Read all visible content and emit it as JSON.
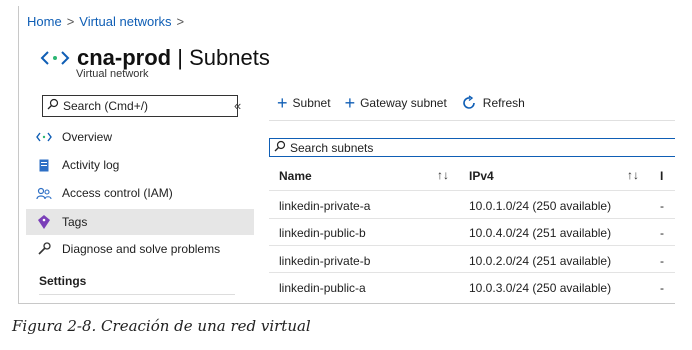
{
  "breadcrumb": {
    "home": "Home",
    "separator": ">",
    "virtual_networks": "Virtual networks"
  },
  "header": {
    "resource": "cna-prod",
    "divider": "|",
    "blade": "Subnets",
    "subtitle": "Virtual network"
  },
  "sidebar": {
    "search_placeholder": "Search (Cmd+/)",
    "collapse": "«",
    "items": [
      {
        "label": "Overview",
        "icon": "vnet-icon"
      },
      {
        "label": "Activity log",
        "icon": "activity-log-icon"
      },
      {
        "label": "Access control (IAM)",
        "icon": "iam-icon"
      },
      {
        "label": "Tags",
        "icon": "tag-icon"
      },
      {
        "label": "Diagnose and solve problems",
        "icon": "wrench-icon"
      }
    ],
    "section": "Settings"
  },
  "toolbar": {
    "subnet": "Subnet",
    "gateway_subnet": "Gateway subnet",
    "refresh": "Refresh"
  },
  "grid": {
    "search_placeholder": "Search subnets",
    "columns": [
      "Name",
      "IPv4",
      "I"
    ],
    "sort_glyph": "↑↓",
    "rows": [
      {
        "name": "linkedin-private-a",
        "ipv4": "10.0.1.0/24 (250 available)",
        "extra": "-"
      },
      {
        "name": "linkedin-public-b",
        "ipv4": "10.0.4.0/24 (251 available)",
        "extra": "-"
      },
      {
        "name": "linkedin-private-b",
        "ipv4": "10.0.2.0/24 (251 available)",
        "extra": "-"
      },
      {
        "name": "linkedin-public-a",
        "ipv4": "10.0.3.0/24 (250 available)",
        "extra": "-"
      }
    ]
  },
  "caption": "Figura 2-8. Creación de una red virtual",
  "colors": {
    "accent": "#0f5eb5",
    "selected_bg": "#e6e6e6",
    "tag_purple": "#7a3fb8",
    "iam_blue": "#2d6fc5"
  }
}
